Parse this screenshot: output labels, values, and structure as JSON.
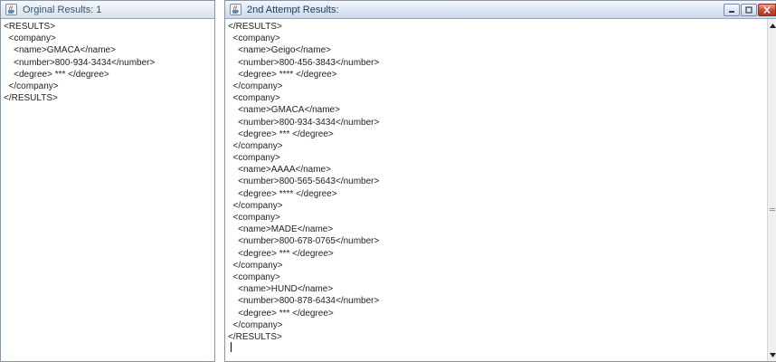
{
  "windows": [
    {
      "id": "original",
      "title": "Orginal Results: 1",
      "lines": [
        "<RESULTS>",
        "  <company>",
        "    <name>GMACA</name>",
        "    <number>800-934-3434</number>",
        "    <degree> *** </degree>",
        "  </company>",
        "</RESULTS>"
      ]
    },
    {
      "id": "second",
      "title": "2nd Attempt Results:",
      "lines": [
        "</RESULTS>",
        "  <company>",
        "    <name>Geigo</name>",
        "    <number>800-456-3843</number>",
        "    <degree> **** </degree>",
        "  </company>",
        "  <company>",
        "    <name>GMACA</name>",
        "    <number>800-934-3434</number>",
        "    <degree> *** </degree>",
        "  </company>",
        "  <company>",
        "    <name>AAAA</name>",
        "    <number>800-565-5643</number>",
        "    <degree> **** </degree>",
        "  </company>",
        "  <company>",
        "    <name>MADE</name>",
        "    <number>800-678-0765</number>",
        "    <degree> *** </degree>",
        "  </company>",
        "  <company>",
        "    <name>HUND</name>",
        "    <number>800-878-6434</number>",
        "    <degree> *** </degree>",
        "  </company>",
        "</RESULTS>"
      ]
    }
  ],
  "icons": {
    "window_icon": "java-cup-icon",
    "minimize": "minimize-icon",
    "maximize": "maximize-icon",
    "close": "close-icon",
    "scroll_up": "arrow-up-icon",
    "scroll_down": "arrow-down-icon"
  },
  "colors": {
    "titlebar_text": "#1e395b",
    "close_button": "#c7462f",
    "border": "#8b96a4"
  }
}
